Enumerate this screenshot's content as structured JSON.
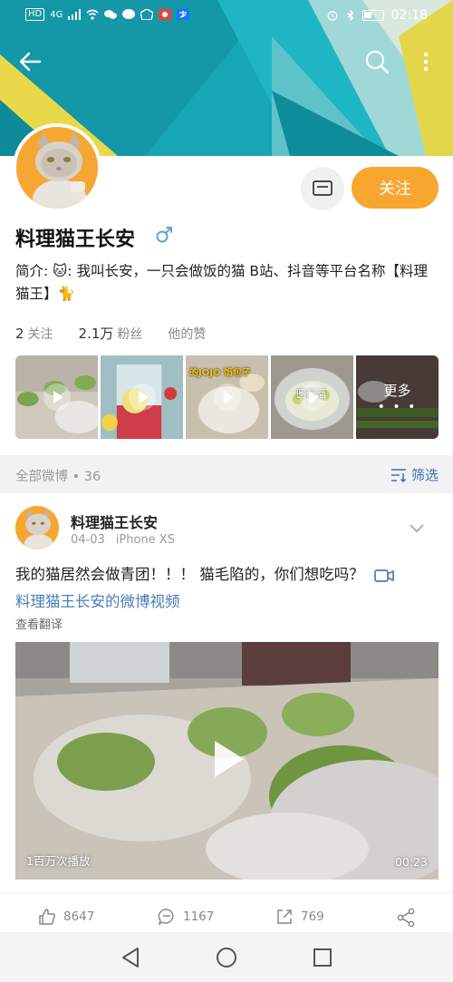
{
  "status_bar": {
    "hd": "HD",
    "network": "4G",
    "time": "02:18"
  },
  "profile": {
    "name": "料理猫王长安",
    "bio": "简介: 🐱: 我叫长安，一只会做饭的猫 B站、抖音等平台名称【料理猫王】🐈",
    "follow_label": "关注",
    "stats": {
      "following_count": "2",
      "following_label": "关注",
      "fans_count": "2.1万",
      "fans_label": "粉丝",
      "likes_label": "他的赞"
    }
  },
  "thumbnails": {
    "more_label": "更多",
    "more_dots": "• • •",
    "items": [
      {
        "name": "thumb-1"
      },
      {
        "name": "thumb-2"
      },
      {
        "name": "thumb-3",
        "caption": "的JOJO 馅包子"
      },
      {
        "name": "thumb-4",
        "caption": "圆溜溜"
      },
      {
        "name": "thumb-5"
      }
    ]
  },
  "filter": {
    "label": "全部微博 • 36",
    "button_label": "筛选"
  },
  "post": {
    "author": "料理猫王长安",
    "date": "04-03",
    "device": "iPhone XS",
    "text": "我的猫居然会做青团！！！ 猫毛陷的，你们想吃吗？",
    "link_text": "料理猫王长安的微博视频",
    "translate_label": "查看翻译",
    "video": {
      "views": "1百万次播放",
      "duration": "00:23"
    },
    "actions": {
      "likes": "8647",
      "comments": "1167",
      "reposts": "769"
    }
  },
  "colors": {
    "accent_orange": "#f7a630",
    "link_blue": "#4a7cb8",
    "banner_teal": "#1aa7b5"
  }
}
